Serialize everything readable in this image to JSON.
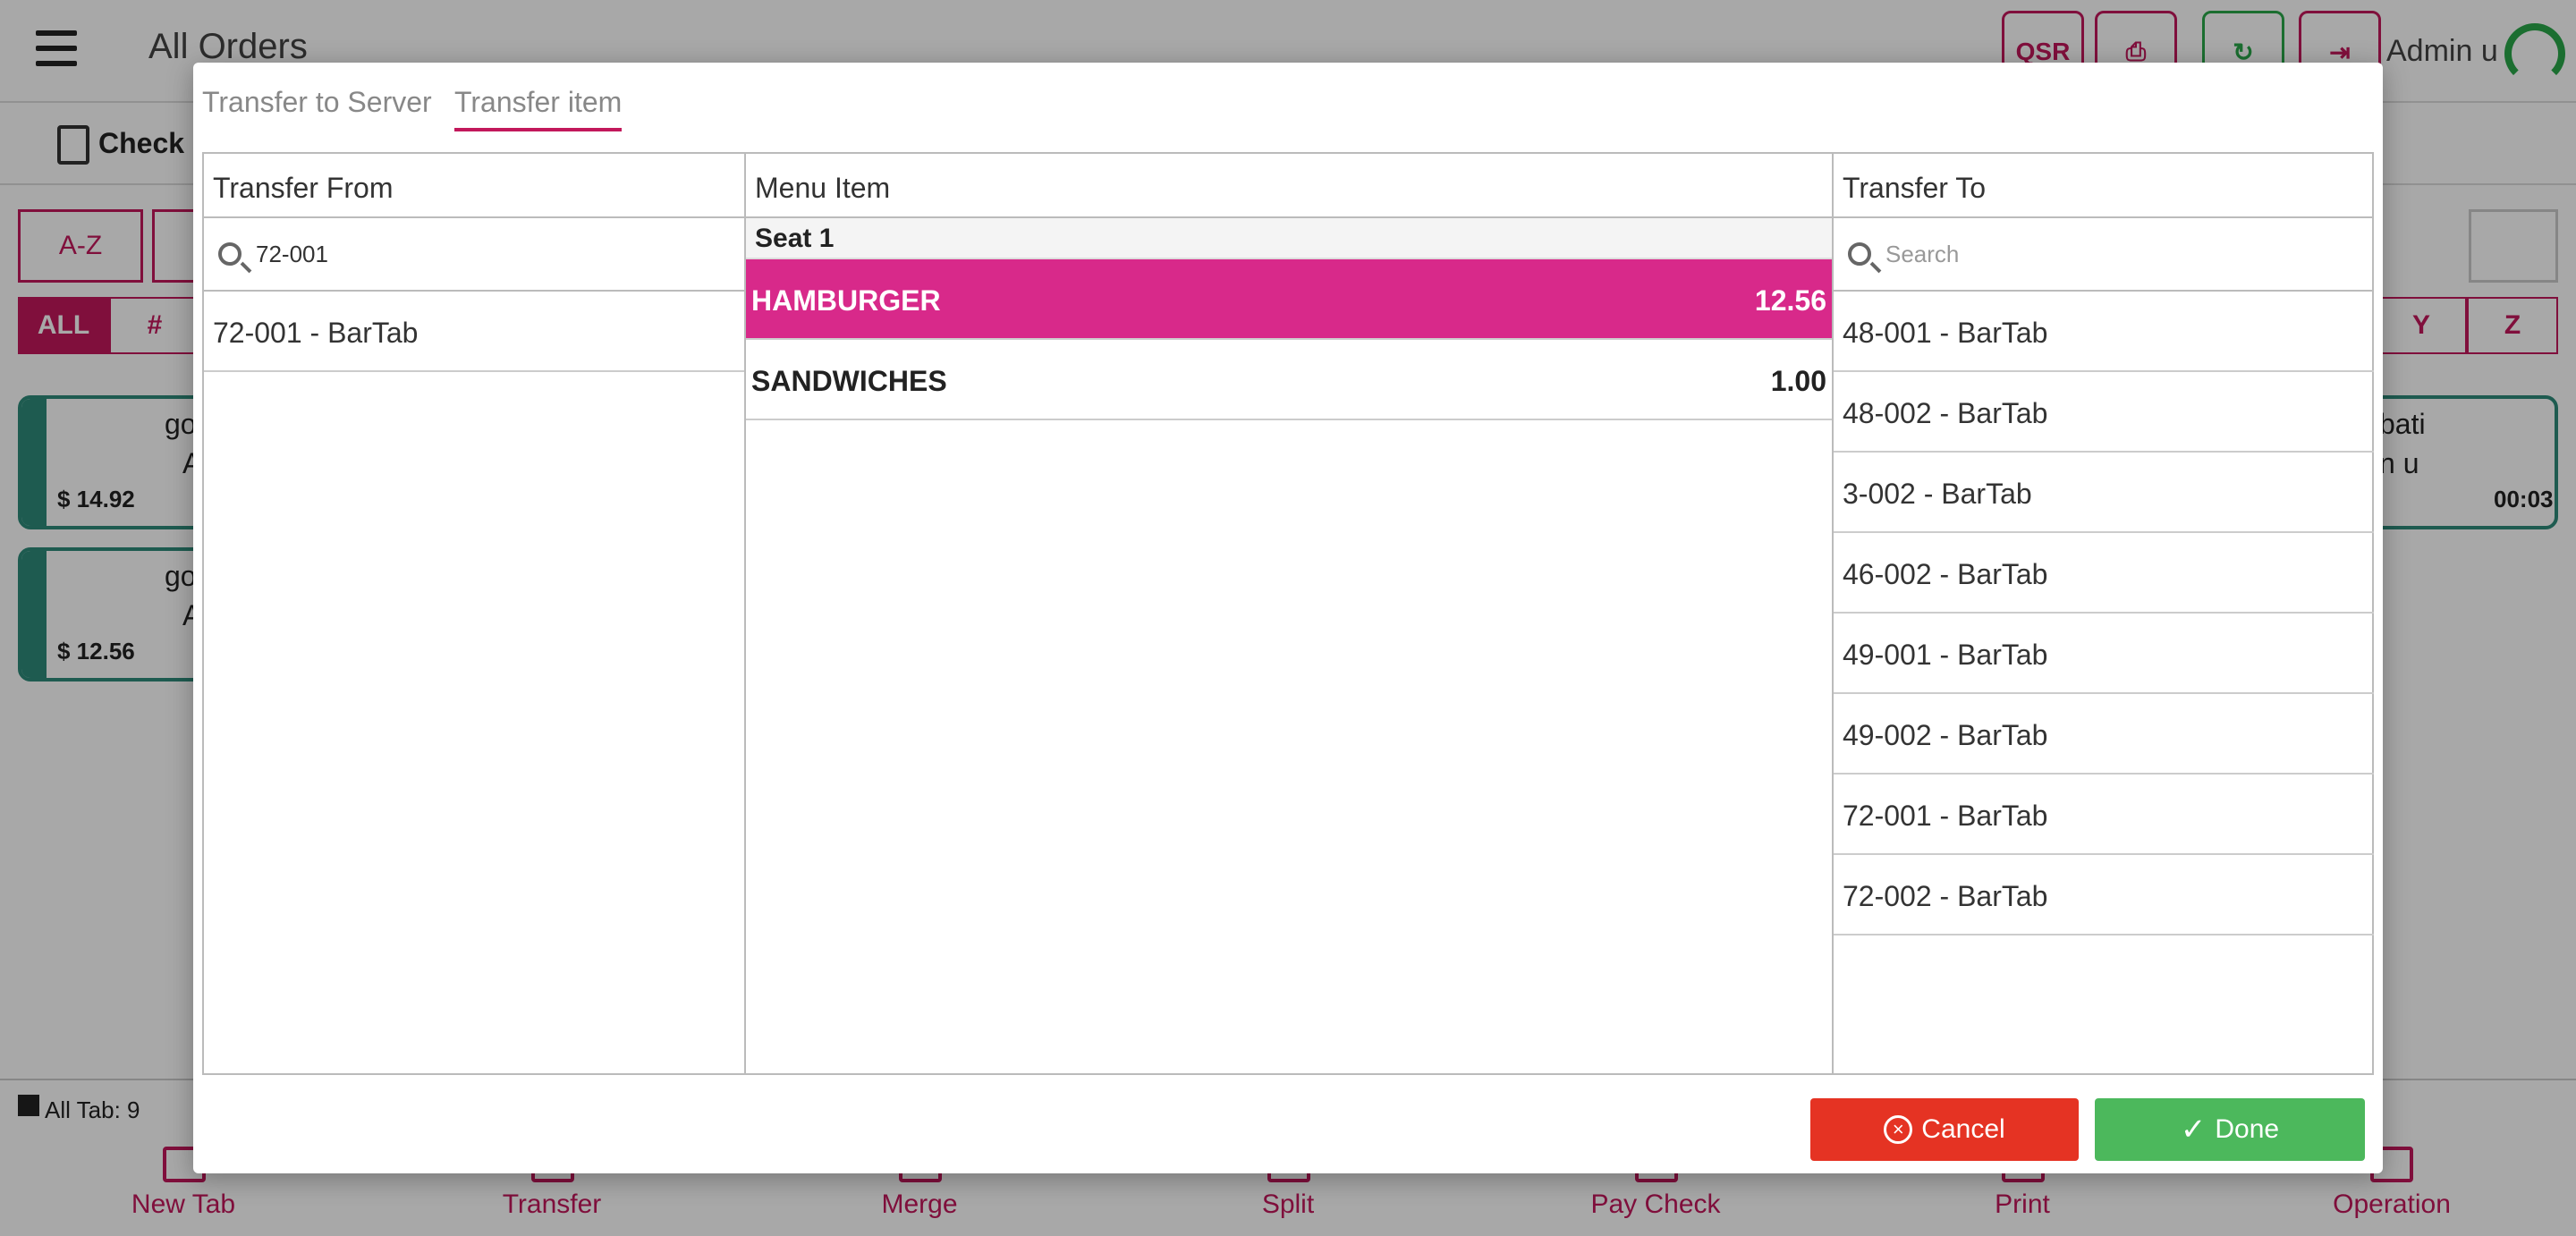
{
  "app": {
    "title": "All Orders",
    "qsr_label": "QSR",
    "admin_label": "Admin u",
    "check_label": "Check S",
    "filters": [
      "A-Z"
    ],
    "letters": [
      "ALL",
      "#",
      "Y",
      "Z"
    ],
    "tabs": [
      {
        "line1": "go",
        "line2": "A",
        "amount": "$ 14.92"
      },
      {
        "line1": "go",
        "line2": "A",
        "amount": "$ 12.56"
      },
      {
        "line1": "bati",
        "line2": "n u",
        "time": "00:03"
      }
    ],
    "status_text": "All Tab: 9",
    "bottom_nav": [
      "New Tab",
      "Transfer",
      "Merge",
      "Split",
      "Pay Check",
      "Print",
      "Operation"
    ]
  },
  "modal": {
    "tabs": [
      {
        "label": "Transfer to Server",
        "active": false
      },
      {
        "label": "Transfer item",
        "active": true
      }
    ],
    "from": {
      "header": "Transfer From",
      "search_value": "72-001",
      "items": [
        "72-001 - BarTab"
      ]
    },
    "menu": {
      "header": "Menu Item",
      "seat_label": "Seat 1",
      "items": [
        {
          "name": "HAMBURGER",
          "price": "12.56",
          "selected": true
        },
        {
          "name": "SANDWICHES",
          "price": "1.00",
          "selected": false
        }
      ]
    },
    "to": {
      "header": "Transfer To",
      "search_placeholder": "Search",
      "items": [
        "48-001 - BarTab",
        "48-002 - BarTab",
        "3-002 - BarTab",
        "46-002 - BarTab",
        "49-001 - BarTab",
        "49-002 - BarTab",
        "72-001 - BarTab",
        "72-002 - BarTab"
      ]
    },
    "cancel_label": "Cancel",
    "done_label": "Done"
  },
  "colors": {
    "accent": "#c2185b",
    "selected_row": "#d8298a",
    "cancel": "#e53323",
    "done": "#4cb85c",
    "tab_border": "#2e8b7a"
  }
}
